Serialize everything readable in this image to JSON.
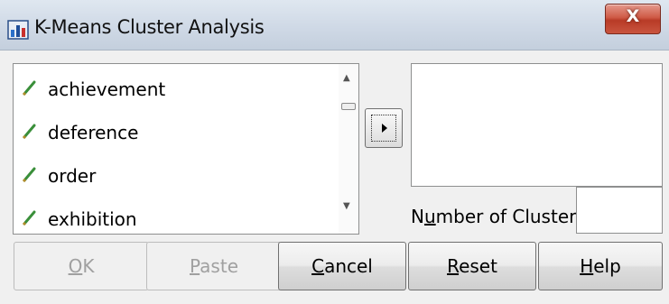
{
  "window": {
    "title": "K-Means Cluster Analysis",
    "close_label": "X"
  },
  "variables": [
    {
      "label": "achievement"
    },
    {
      "label": "deference"
    },
    {
      "label": "order"
    },
    {
      "label": "exhibition"
    }
  ],
  "clusters": {
    "label_before": "N",
    "label_mnemonic": "u",
    "label_after": "mber of Clusters:",
    "value": ""
  },
  "buttons": {
    "ok": {
      "mnemonic": "O",
      "rest": "K",
      "enabled": false
    },
    "paste": {
      "mnemonic": "P",
      "rest": "aste",
      "enabled": false
    },
    "cancel": {
      "mnemonic": "C",
      "rest": "ancel",
      "enabled": true
    },
    "reset": {
      "mnemonic": "R",
      "rest": "eset",
      "enabled": true
    },
    "help": {
      "mnemonic": "H",
      "rest": "elp",
      "enabled": true
    }
  },
  "colors": {
    "pencil_icon": "#3a8f3a",
    "close_button": "#c9553f",
    "window_bg": "#f0f0f0"
  }
}
